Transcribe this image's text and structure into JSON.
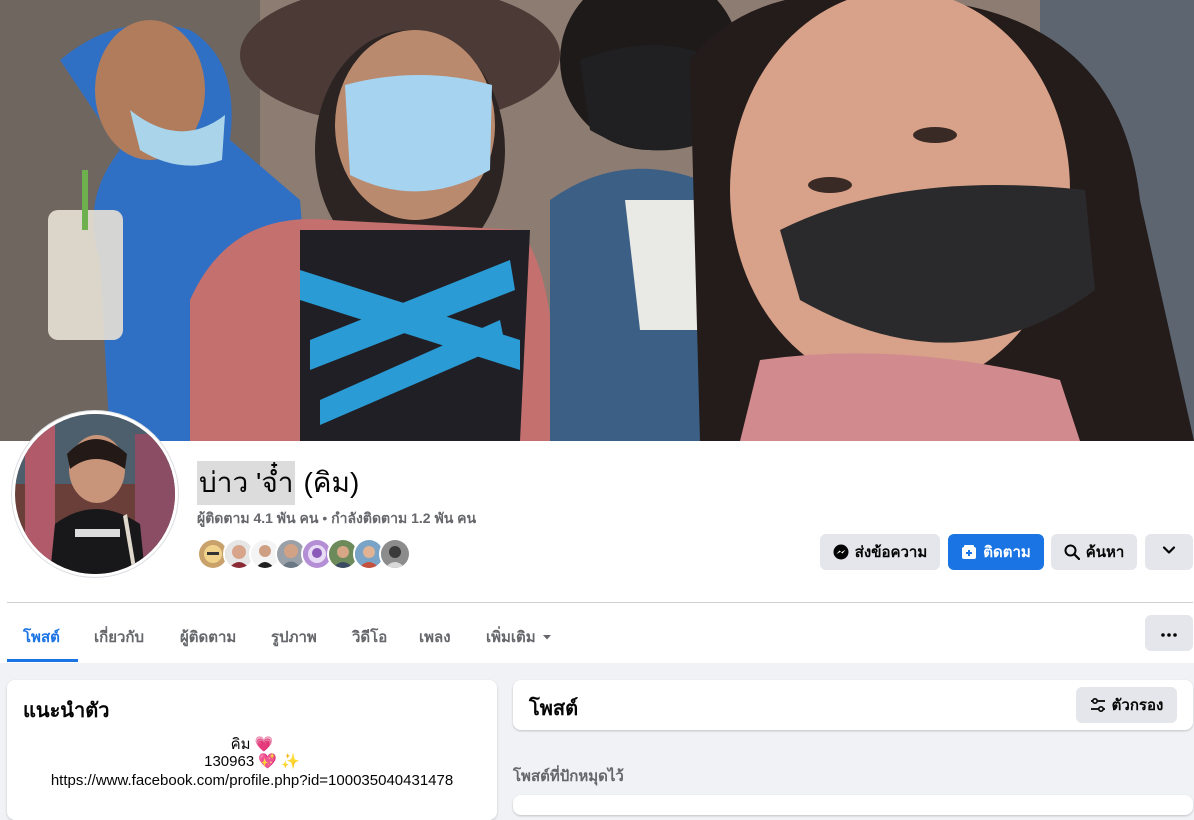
{
  "profile": {
    "name_primary": "บ่าว 'จ๋ำ",
    "name_secondary": "(คิม)",
    "followers_text": "ผู้ติดตาม 4.1 พัน คน",
    "separator": "•",
    "following_text": "กำลังติดตาม 1.2 พัน คน"
  },
  "actions": {
    "message_label": "ส่งข้อความ",
    "follow_label": "ติดตาม",
    "search_label": "ค้นหา"
  },
  "tabs": [
    {
      "label": "โพสต์"
    },
    {
      "label": "เกี่ยวกับ"
    },
    {
      "label": "ผู้ติดตาม"
    },
    {
      "label": "รูปภาพ"
    },
    {
      "label": "วิดีโอ"
    },
    {
      "label": "เพลง"
    },
    {
      "label": "เพิ่มเติม"
    }
  ],
  "intro": {
    "title": "แนะนำตัว",
    "line1": "คิม 💗",
    "line2": "130963 💖 ✨",
    "line3": "https://www.facebook.com/profile.php?id=100035040431478"
  },
  "posts": {
    "title": "โพสต์",
    "filter_label": "ตัวกรอง",
    "pinned_label": "โพสต์ที่ปักหมุดไว้"
  },
  "colors": {
    "accent": "#1b74e4",
    "page_bg": "#f0f2f5",
    "button_grey": "#e4e6eb"
  }
}
